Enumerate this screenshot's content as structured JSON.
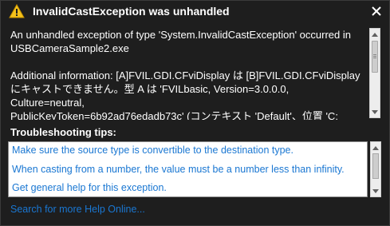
{
  "dialog": {
    "title": "InvalidCastException was unhandled",
    "close_icon": "close-icon",
    "warning_icon": "warning-icon"
  },
  "message": {
    "line1": "An unhandled exception of type 'System.InvalidCastException' occurred in",
    "line2": "USBCameraSample2.exe",
    "line3": "Additional information: [A]FVIL.GDI.CFviDisplay は [B]FVIL.GDI.CFviDisplay",
    "line4": "にキャストできません。型 A は 'FVILbasic, Version=3.0.0.0, Culture=neutral,",
    "line5": "PublicKeyToken=6b92ad76edadb73c' (コンテキスト 'Default'、位置 'C:"
  },
  "troubleshooting": {
    "title": "Troubleshooting tips:",
    "tips": [
      "Make sure the source type is convertible to the destination type.",
      "When casting from a number, the value must be a number less than infinity.",
      "Get general help for this exception."
    ]
  },
  "help_link": "Search for more Help Online...",
  "colors": {
    "background": "#1e1e1e",
    "link": "#1a77d2",
    "warning": "#f5c21b"
  }
}
